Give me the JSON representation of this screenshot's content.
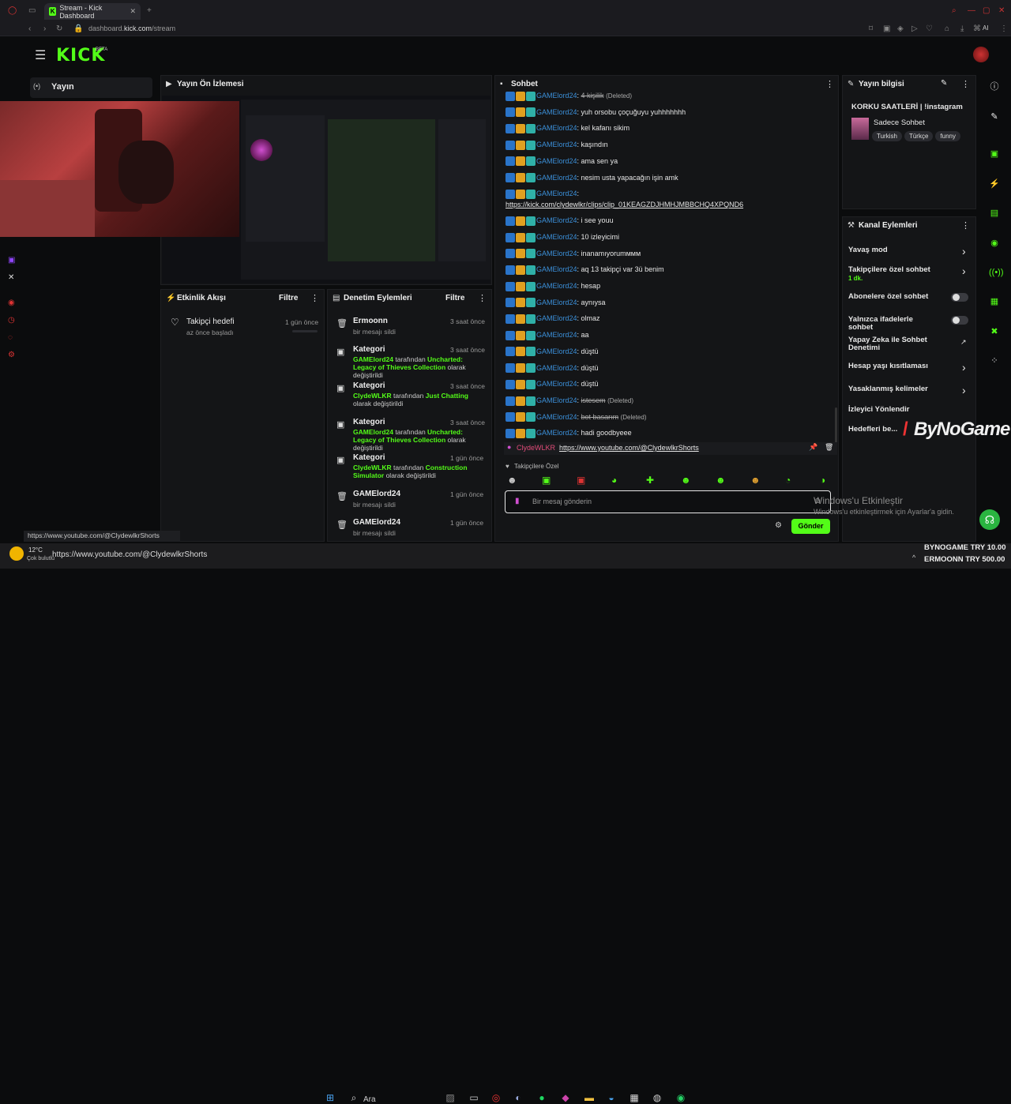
{
  "browser": {
    "tab_title": "Stream - Kick Dashboard",
    "url": "dashboard.kick.com/stream",
    "url_host": "kick.com",
    "address_prefix": "dashboard.",
    "address_suffix": "/stream",
    "profile": "AI"
  },
  "brand": {
    "logo": "KICK",
    "beta": "BETA",
    "accent": "#53fc18"
  },
  "nav": {
    "stream_label": "Yayın"
  },
  "preview": {
    "title": "Yayın Ön İzlemesi"
  },
  "activity": {
    "title": "Etkinlik Akışı",
    "filter": "Filtre",
    "items": [
      {
        "title": "Takipçi hedefi",
        "sub": "az önce başladı",
        "time": "1 gün önce"
      }
    ]
  },
  "moderation": {
    "title": "Denetim Eylemleri",
    "filter": "Filtre",
    "items": [
      {
        "title": "Ermoonn",
        "sub": "bir mesajı sildi",
        "time": "3 saat önce",
        "icon": "trash-icon"
      },
      {
        "title": "Kategori",
        "user": "GAMElord24",
        "mid": "tarafından",
        "game": "Uncharted: Legacy of Thieves Collection",
        "end": "olarak değiştirildi",
        "time": "3 saat önce",
        "icon": "category-icon"
      },
      {
        "title": "Kategori",
        "user": "ClydeWLKR",
        "mid": "tarafından",
        "game": "Just Chatting",
        "end": "olarak değiştirildi",
        "time": "3 saat önce",
        "icon": "category-icon"
      },
      {
        "title": "Kategori",
        "user": "GAMElord24",
        "mid": "tarafından",
        "game": "Uncharted: Legacy of Thieves Collection",
        "end": "olarak değiştirildi",
        "time": "3 saat önce",
        "icon": "category-icon"
      },
      {
        "title": "Kategori",
        "user": "ClydeWLKR",
        "mid": "tarafından",
        "game": "Construction Simulator",
        "end": "olarak değiştirildi",
        "time": "1 gün önce",
        "icon": "category-icon"
      },
      {
        "title": "GAMElord24",
        "sub": "bir mesajı sildi",
        "time": "1 gün önce",
        "icon": "trash-icon"
      },
      {
        "title": "GAMElord24",
        "sub": "bir mesajı sildi",
        "time": "1 gün önce",
        "icon": "trash-icon"
      }
    ]
  },
  "chat": {
    "title": "Sohbet",
    "user": "GAMElord24",
    "messages": [
      {
        "text": "4 kişilik",
        "deleted": "(Deleted)"
      },
      {
        "text": "yuh orsobu çoçuğuyu yuhhhhhhh"
      },
      {
        "text": "kel kafanı sikim"
      },
      {
        "text": "kaşındın"
      },
      {
        "text": "ama sen ya"
      },
      {
        "text": "nesim usta yapacağın işin amk"
      },
      {
        "text": "",
        "link": "https://kick.com/clydewlkr/clips/clip_01KEAGZDJHMHJMBBCHQ4XPQND6"
      },
      {
        "text": "i see youu"
      },
      {
        "text": "10 izleyicimi"
      },
      {
        "text": "inanamıyorumммм"
      },
      {
        "text": "aq 13 takipçi var 3ü benim"
      },
      {
        "text": "hesap"
      },
      {
        "text": "aynıysa"
      },
      {
        "text": "olmaz"
      },
      {
        "text": "aa"
      },
      {
        "text": "düştü"
      },
      {
        "text": "düştü"
      },
      {
        "text": "düştü"
      },
      {
        "text": "istesem",
        "deleted": "(Deleted)"
      },
      {
        "text": "bot basarım",
        "deleted": "(Deleted)"
      },
      {
        "text": "hadi goodbyeee"
      }
    ],
    "last_user": "ClydeWLKR",
    "last_link": "https://www.youtube.com/@ClydewlkrShorts",
    "followers_only": "Takipçilere Özel",
    "input_placeholder": "Bir mesaj gönderin",
    "send": "Gönder"
  },
  "stream_info": {
    "title": "Yayın bilgisi",
    "stream_title": "KORKU SAATLERİ | !instagram",
    "category": "Sadece Sohbet",
    "tags": [
      "Turkish",
      "Türkçe",
      "funny"
    ]
  },
  "channel_actions": {
    "title": "Kanal Eylemleri",
    "items": [
      {
        "label": "Yavaş mod",
        "type": "arrow"
      },
      {
        "label": "Takipçilere özel sohbet",
        "sub": "1 dk.",
        "type": "arrow"
      },
      {
        "label": "Abonelere özel sohbet",
        "type": "toggle"
      },
      {
        "label": "Yalnızca ifadelerle sohbet",
        "type": "toggle"
      },
      {
        "label": "Yapay Zeka ile Sohbet Denetimi",
        "type": "external"
      },
      {
        "label": "Hesap yaşı kısıtlaması",
        "type": "arrow"
      },
      {
        "label": "Yasaklanmış kelimeler",
        "type": "arrow"
      },
      {
        "label": "İzleyici Yönlendir",
        "type": "none"
      },
      {
        "label": "Hedefleri be...",
        "type": "none"
      }
    ]
  },
  "watermark": "ByNoGame",
  "windows": {
    "activate_title": "Windows'u Etkinleştir",
    "activate_sub": "Windows'u etkinleştirmek için Ayarlar'a gidin."
  },
  "status_url": "https://www.youtube.com/@ClydewlkrShorts",
  "taskbar": {
    "weather_temp": "12°C",
    "weather_desc": "Çok bulutlu",
    "search": "Ara",
    "tray_line1": "BYNOGAME  TRY 10.00",
    "tray_line2": "ERMOONN  TRY 500.00"
  }
}
